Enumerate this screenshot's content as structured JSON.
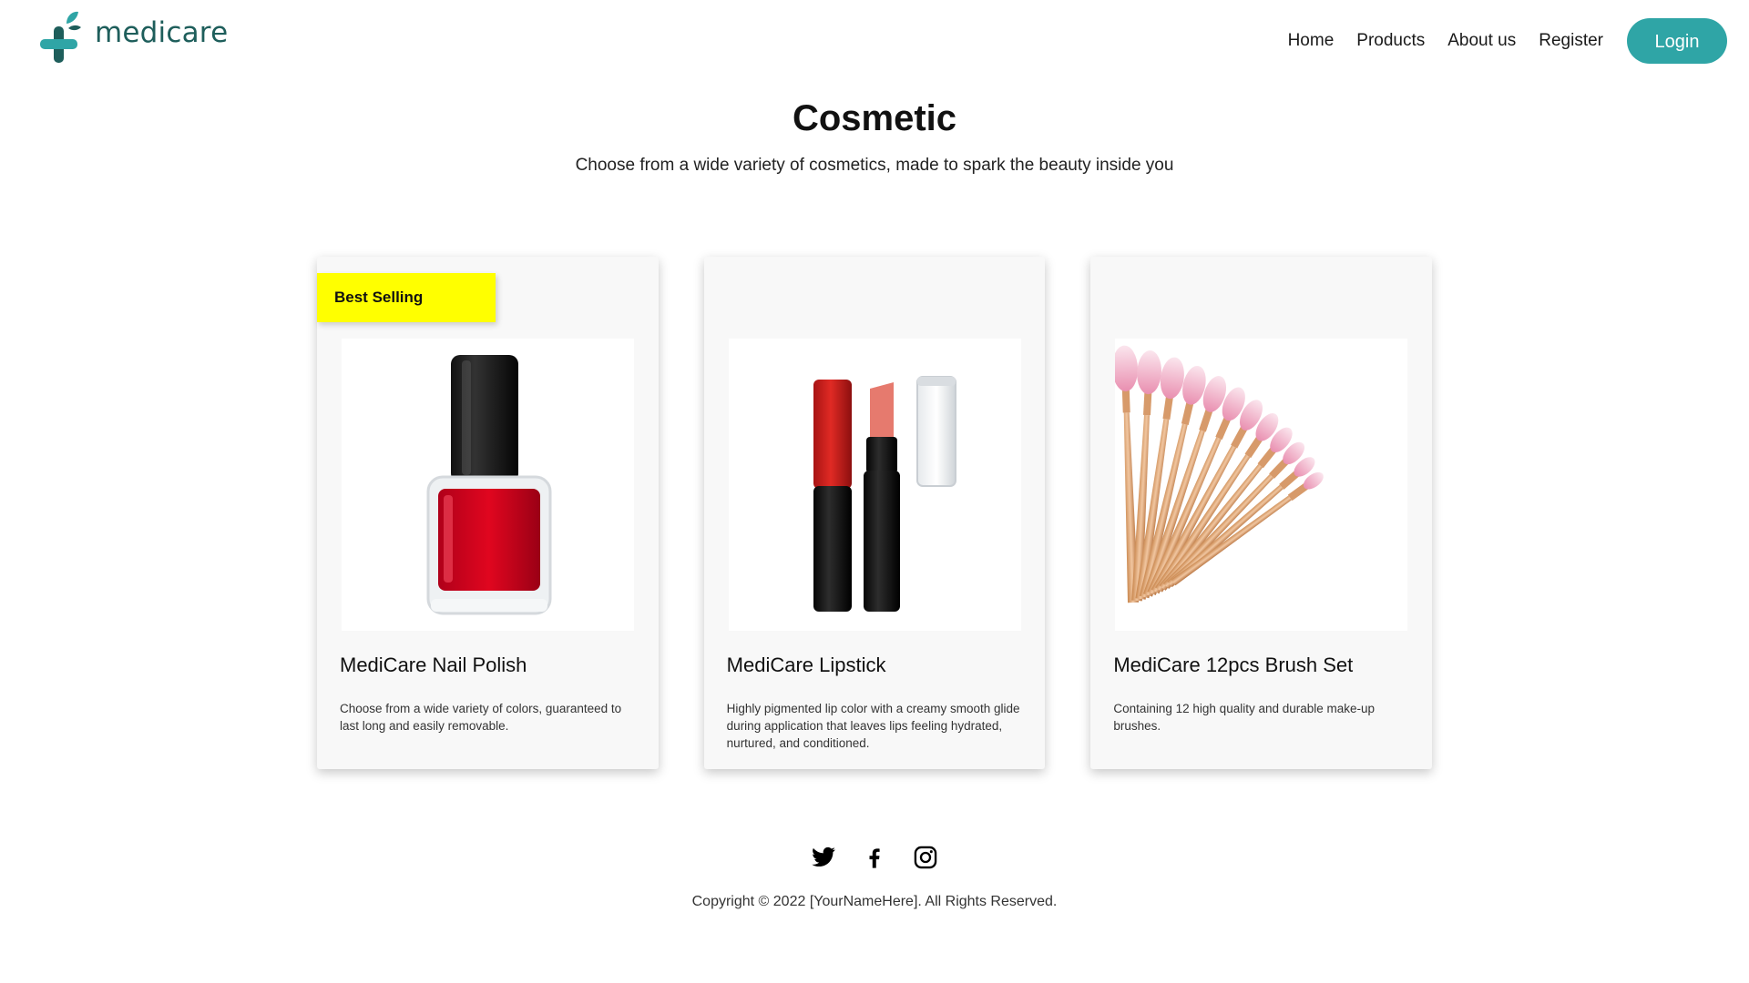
{
  "header": {
    "logo_text": "medicare",
    "nav": [
      {
        "label": "Home",
        "icon": ""
      },
      {
        "label": "Products",
        "icon": ""
      },
      {
        "label": "About us",
        "icon": ""
      },
      {
        "label": "Register",
        "icon": ""
      }
    ],
    "login_label": "Login"
  },
  "hero": {
    "title": "Cosmetic",
    "subtitle": "Choose from a wide variety of cosmetics, made to spark the beauty inside you"
  },
  "products": [
    {
      "badge": "Best Selling",
      "title": "MediCare Nail Polish",
      "description": "Choose from a wide variety of colors, guaranteed to last long and easily removable.",
      "image": "nail-polish-image"
    },
    {
      "badge": "",
      "title": "MediCare Lipstick",
      "description": "Highly pigmented lip color with a creamy smooth glide during application that leaves lips feeling hydrated, nurtured, and conditioned.",
      "image": "lipstick-image"
    },
    {
      "badge": "",
      "title": "MediCare 12pcs Brush Set",
      "description": "Containing 12 high quality and durable make-up brushes.",
      "image": "brush-set-image"
    }
  ],
  "footer": {
    "social_icons": [
      "twitter-icon",
      "facebook-icon",
      "instagram-icon"
    ],
    "copyright": "Copyright © 2022 [YourNameHere]. All Rights Reserved."
  },
  "colors": {
    "accent": "#2fa5a6",
    "brand_text": "#1e5e5b",
    "badge": "#ffff00",
    "card_bg": "#f8f8f8"
  }
}
